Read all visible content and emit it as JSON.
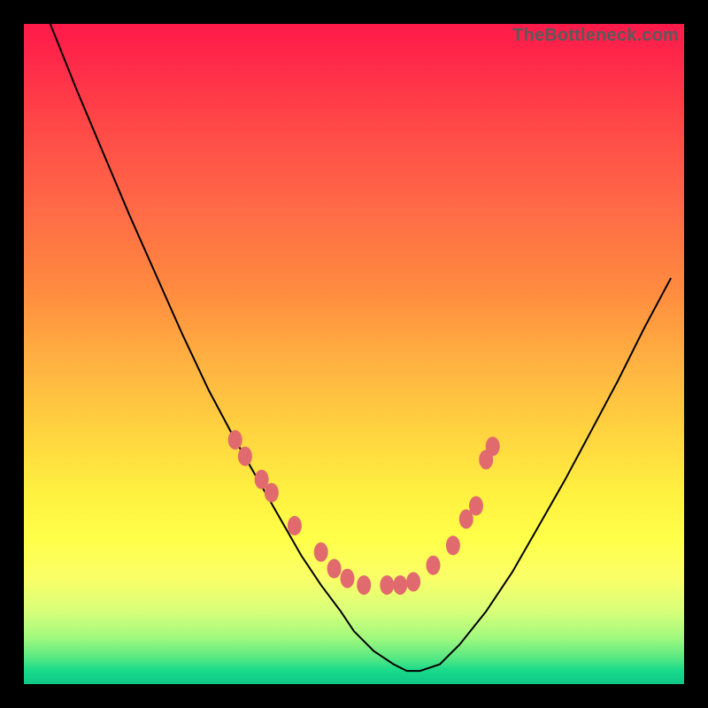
{
  "watermark": "TheBottleneck.com",
  "chart_data": {
    "type": "line",
    "title": "",
    "xlabel": "",
    "ylabel": "",
    "xlim": [
      0,
      100
    ],
    "ylim": [
      0,
      100
    ],
    "legend": false,
    "grid": false,
    "background": "vertical-gradient red→orange→yellow→green",
    "series": [
      {
        "name": "bottleneck-curve",
        "x": [
          4,
          8,
          12,
          16,
          20,
          24,
          28,
          32,
          36,
          40,
          42,
          45,
          48,
          50,
          53,
          56,
          58,
          60,
          63,
          66,
          70,
          74,
          78,
          82,
          86,
          90,
          94,
          98
        ],
        "y": [
          100,
          90,
          80.5,
          71,
          62,
          53,
          44.5,
          37,
          30,
          23,
          19.5,
          15,
          11,
          8,
          5,
          3,
          2,
          2,
          3,
          6,
          11,
          17,
          24,
          31,
          38.5,
          46,
          54,
          61.5
        ]
      }
    ],
    "markers": {
      "name": "highlight-markers",
      "points": [
        {
          "x": 32,
          "y": 37
        },
        {
          "x": 33.5,
          "y": 34.5
        },
        {
          "x": 36,
          "y": 31
        },
        {
          "x": 37.5,
          "y": 29
        },
        {
          "x": 41,
          "y": 24
        },
        {
          "x": 45,
          "y": 20
        },
        {
          "x": 47,
          "y": 17.5
        },
        {
          "x": 49,
          "y": 16
        },
        {
          "x": 51.5,
          "y": 15
        },
        {
          "x": 55,
          "y": 15
        },
        {
          "x": 57,
          "y": 15
        },
        {
          "x": 59,
          "y": 15.5
        },
        {
          "x": 62,
          "y": 18
        },
        {
          "x": 65,
          "y": 21
        },
        {
          "x": 67,
          "y": 25
        },
        {
          "x": 68.5,
          "y": 27
        },
        {
          "x": 70,
          "y": 34
        },
        {
          "x": 71,
          "y": 36
        }
      ]
    }
  }
}
